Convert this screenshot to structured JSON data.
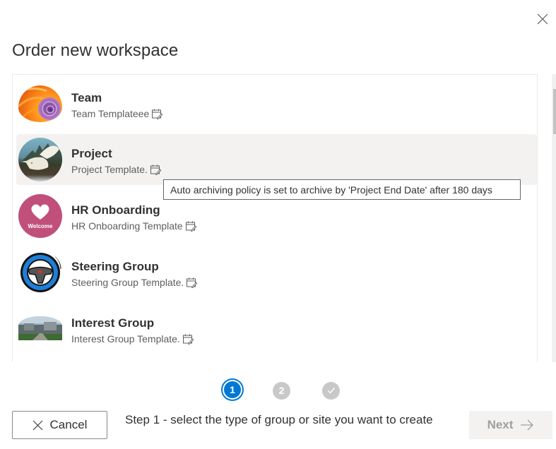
{
  "dialog": {
    "title": "Order new workspace",
    "close_icon": "close-icon"
  },
  "templates": [
    {
      "title": "Team",
      "subtitle": "Team Templateee",
      "icon": "calendar-edit-icon",
      "avatar": "nautilus-shell-image",
      "selected": false
    },
    {
      "title": "Project",
      "subtitle": "Project Template.",
      "icon": "calendar-edit-icon",
      "avatar": "snowy-owl-image",
      "selected": true
    },
    {
      "title": "HR Onboarding",
      "subtitle": "HR Onboarding Template",
      "icon": "calendar-edit-icon",
      "avatar": "welcome-heart-image",
      "avatar_text": "Welcome",
      "selected": false
    },
    {
      "title": "Steering Group",
      "subtitle": "Steering Group Template.",
      "icon": "calendar-edit-icon",
      "avatar": "steering-wheel-image",
      "selected": false
    },
    {
      "title": "Interest Group",
      "subtitle": "Interest Group Template.",
      "icon": "calendar-edit-icon",
      "avatar": "building-landscape-image",
      "selected": false
    }
  ],
  "tooltip": {
    "text": "Auto archiving policy is set to archive by 'Project End Date' after 180 days"
  },
  "stepper": {
    "current_step": 1,
    "steps": [
      {
        "label": "1",
        "state": "active"
      },
      {
        "label": "2",
        "state": "inactive"
      },
      {
        "label": "",
        "icon": "checkmark-icon",
        "state": "inactive"
      }
    ]
  },
  "footer": {
    "cancel_label": "Cancel",
    "step_description": "Step 1 - select the type of group or site you want to create",
    "next_label": "Next",
    "next_enabled": false
  },
  "colors": {
    "accent": "#0078d4",
    "selected_row": "#f3f2f1",
    "step_inactive": "#c8c8c8",
    "disabled_text": "#a19f9d"
  }
}
